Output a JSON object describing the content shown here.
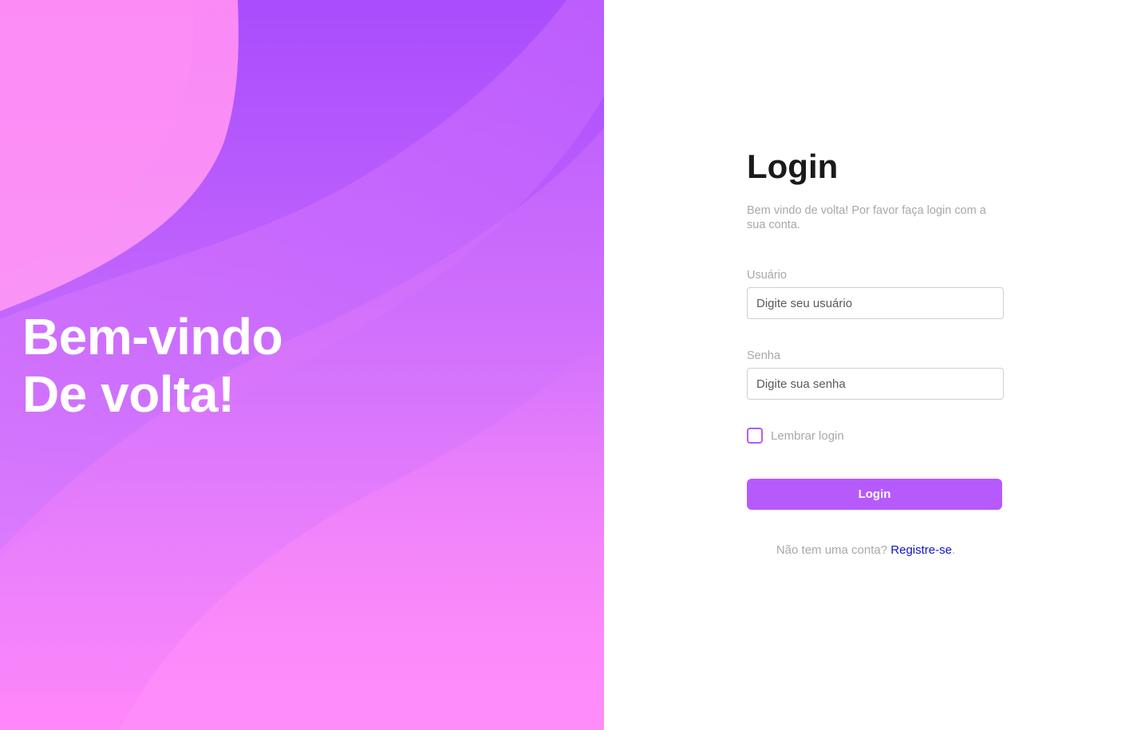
{
  "hero": {
    "line1": "Bem-vindo",
    "line2": "De volta!"
  },
  "form": {
    "title": "Login",
    "subtitle": "Bem vindo de volta! Por favor faça login com a sua conta.",
    "username": {
      "label": "Usuário",
      "placeholder": "Digite seu usuário",
      "value": ""
    },
    "password": {
      "label": "Senha",
      "placeholder": "Digite sua senha",
      "value": ""
    },
    "remember": {
      "label": "Lembrar login",
      "checked": false
    },
    "submit_label": "Login",
    "signup": {
      "prompt": "Não tem uma conta?",
      "link_label": "Registre-se",
      "suffix": "."
    }
  },
  "colors": {
    "accent": "#b65afc",
    "hero_top": "#a94dfd",
    "hero_bottom": "#ff88fb",
    "link": "#0a14c8",
    "muted_text": "#a8a8a8"
  }
}
